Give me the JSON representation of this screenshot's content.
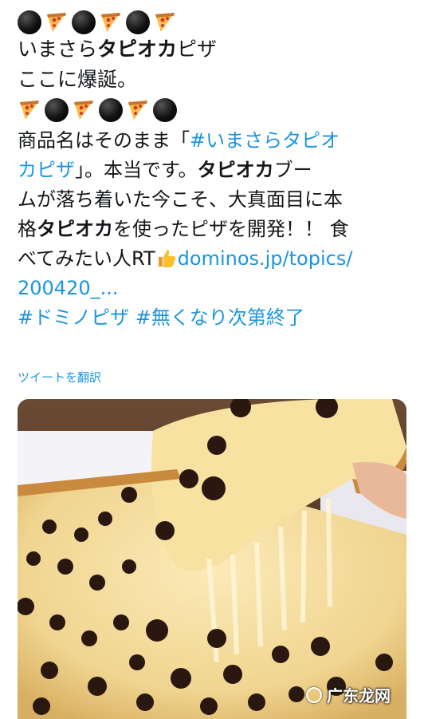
{
  "tweet": {
    "line1": "いまさら",
    "line1_bold": "タピオカ",
    "line1_end": "ピザ",
    "line2": "ここに爆誕。",
    "p1_a": "商品名はそのまま「",
    "p1_hashtag": "#いまさらタピオ",
    "p2_hashtag": "カピザ",
    "p2_a": "」。本当です。",
    "p2_bold": "タピオカ",
    "p2_end": "ブー",
    "p3": "ムが落ち着いた今こそ、大真面目に本",
    "p4_a": "格",
    "p4_bold": "タピオカ",
    "p4_end": "を使ったピザを開発！！ 食",
    "p5_a": "べてみたい人RT",
    "p5_link": "dominos.jp/topics/",
    "p6_link": "200420_...",
    "hashtag1": "#ドミノピザ",
    "hashtag2": "#無くなり次第終了"
  },
  "translate_label": "ツイートを翻訳",
  "icons": [
    "black-circle-icon",
    "pizza-icon",
    "thumbs-up-icon"
  ],
  "media": {
    "alt": "タピオカピザ",
    "watermark": "广东龙网"
  },
  "colors": {
    "link": "#1b95e0",
    "text": "#14171a"
  }
}
